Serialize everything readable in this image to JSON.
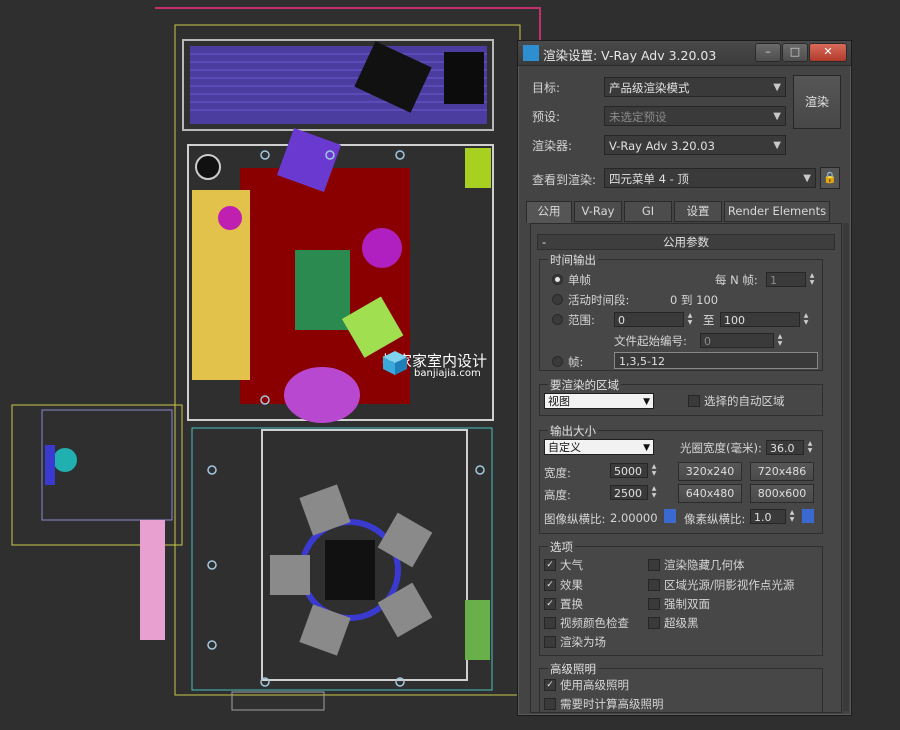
{
  "watermark": {
    "brand": "扮家家室内设计",
    "url": "banjiajia.com"
  },
  "dialog": {
    "title": "渲染设置: V-Ray Adv 3.20.03",
    "window_buttons": {
      "minimize": "–",
      "maximize": "□",
      "close": "✕"
    },
    "target": {
      "label": "目标:",
      "value": "产品级渲染模式"
    },
    "preset": {
      "label": "预设:",
      "value": "未选定预设"
    },
    "renderer": {
      "label": "渲染器:",
      "value": "V-Ray Adv 3.20.03"
    },
    "view_to_render": {
      "label": "查看到渲染:",
      "value": "四元菜单 4 - 顶"
    },
    "render_button": "渲染",
    "tabs": [
      "公用",
      "V-Ray",
      "GI",
      "设置",
      "Render Elements"
    ],
    "active_tab": "公用",
    "rollout": {
      "minus": "-",
      "title": "公用参数"
    },
    "time_output": {
      "title": "时间输出",
      "single": "单帧",
      "every_n_label": "每 N 帧:",
      "every_n_value": "1",
      "active_segment": "活动时间段:",
      "active_range": "0 到 100",
      "range": "范围:",
      "range_from": "0",
      "range_to_label": "至",
      "range_to": "100",
      "file_start_label": "文件起始编号:",
      "file_start": "0",
      "frames": "帧:",
      "frames_value": "1,3,5-12"
    },
    "area": {
      "title": "要渲染的区域",
      "value": "视图",
      "auto_region": "选择的自动区域"
    },
    "output_size": {
      "title": "输出大小",
      "preset": "自定义",
      "aperture_label": "光圈宽度(毫米):",
      "aperture": "36.0",
      "width_label": "宽度:",
      "width": "5000",
      "height_label": "高度:",
      "height": "2500",
      "sizes": [
        "320x240",
        "720x486",
        "640x480",
        "800x600"
      ],
      "image_aspect_label": "图像纵横比:",
      "image_aspect": "2.00000",
      "pixel_aspect_label": "像素纵横比:",
      "pixel_aspect": "1.0"
    },
    "options": {
      "title": "选项",
      "items_left": [
        {
          "label": "大气",
          "checked": true
        },
        {
          "label": "效果",
          "checked": true
        },
        {
          "label": "置换",
          "checked": true
        },
        {
          "label": "视频颜色检查",
          "checked": false
        },
        {
          "label": "渲染为场",
          "checked": false
        }
      ],
      "items_right": [
        {
          "label": "渲染隐藏几何体",
          "checked": false
        },
        {
          "label": "区域光源/阴影视作点光源",
          "checked": false
        },
        {
          "label": "强制双面",
          "checked": false
        },
        {
          "label": "超级黑",
          "checked": false
        }
      ]
    },
    "advanced_lighting": {
      "title": "高级照明",
      "use": {
        "label": "使用高级照明",
        "checked": true
      },
      "compute": {
        "label": "需要时计算高级照明",
        "checked": false
      }
    }
  }
}
